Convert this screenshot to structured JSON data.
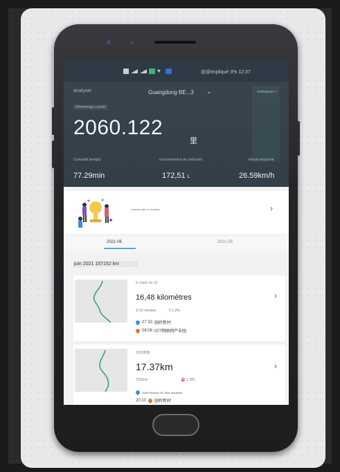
{
  "status_bar": {
    "right_text": "@@impliqué 3% 12:37"
  },
  "header": {
    "analyser_label": "analyser",
    "location": "Guangdong BE...3",
    "top_right_label": "statistiques >",
    "total_label": "Kilométrage cumulé",
    "total_value": "2060.122",
    "total_unit": "里",
    "cumul_label": "Cumulatif (temps)",
    "cumul_value": "77.29min",
    "fuel_label": "consommation de carburant",
    "fuel_value": "172,51",
    "fuel_unit": "L",
    "speed_label": "vitesse moyenne",
    "speed_value": "26.59km/h"
  },
  "banner": {
    "text": "Insérer dans le la trace"
  },
  "tabs": [
    {
      "label": "2021-06",
      "active": true
    },
    {
      "label": "2021-05",
      "active": false
    }
  ],
  "month_summary": "juin 2021 157152 km",
  "trips": [
    {
      "date": "le matin du 29",
      "distance": "16,48 kilomètres",
      "duration": "32 minutes",
      "fuel": "0 1.24L",
      "start_time": "07:33",
      "start_place": "园岭新村",
      "end_time": "08:06",
      "end_place": "IOT物联网产业园"
    },
    {
      "date": "28日夜晚",
      "distance": "17.37km",
      "duration": "32min",
      "fuel": "1.281",
      "start_place": "1946 Période 101 Parc industriel",
      "end_time": "20:10",
      "end_place": "园岭新村"
    }
  ],
  "colors": {
    "header_bg": "#2f3a45",
    "accent": "#3fb4c4",
    "start_pin": "#3a8fd8",
    "end_pin": "#e07a2c"
  }
}
